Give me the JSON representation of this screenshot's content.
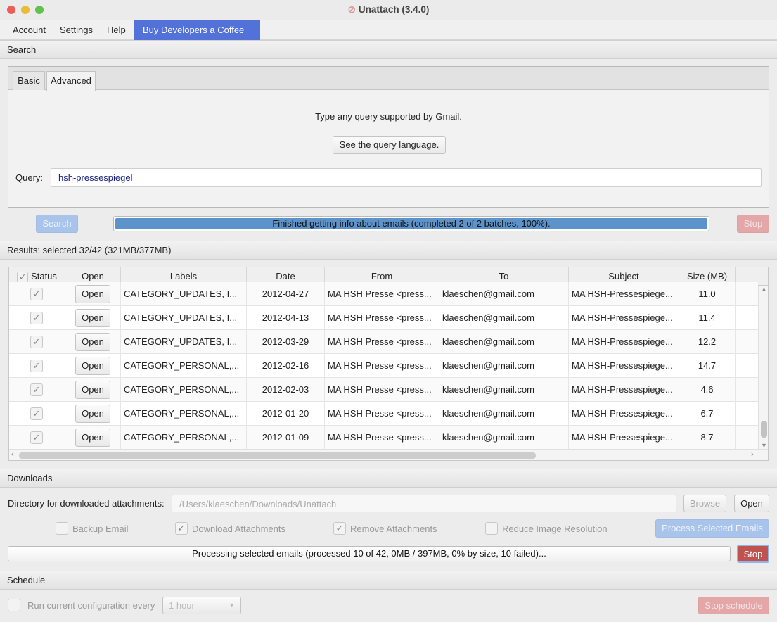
{
  "window": {
    "title": "Unattach (3.4.0)"
  },
  "menu": [
    "Account",
    "Settings",
    "Help",
    "Buy Developers a Coffee ☕"
  ],
  "search": {
    "section": "Search",
    "tabs": [
      "Basic",
      "Advanced"
    ],
    "hint": "Type any query supported by Gmail.",
    "query_lang_button": "See the query language.",
    "query_label": "Query:",
    "query_value": "hsh-pressespiegel",
    "search_button": "Search",
    "progress_text": "Finished getting info about emails (completed 2 of 2 batches, 100%).",
    "progress_percent": 100,
    "stop_button": "Stop"
  },
  "results": {
    "section": "Results: selected 32/42 (321MB/377MB)",
    "columns": [
      "Status",
      "Open",
      "Labels",
      "Date",
      "From",
      "To",
      "Subject",
      "Size (MB)"
    ],
    "rows": [
      {
        "checked": true,
        "open": "Open",
        "labels": "CATEGORY_UPDATES, I...",
        "date": "2012-04-27",
        "from": "MA HSH Presse <press...",
        "to": "klaeschen@gmail.com",
        "subject": "MA HSH-Pressespiege...",
        "size": "11.0"
      },
      {
        "checked": true,
        "open": "Open",
        "labels": "CATEGORY_UPDATES, I...",
        "date": "2012-04-13",
        "from": "MA HSH Presse <press...",
        "to": "klaeschen@gmail.com",
        "subject": "MA HSH-Pressespiege...",
        "size": "11.4"
      },
      {
        "checked": true,
        "open": "Open",
        "labels": "CATEGORY_UPDATES, I...",
        "date": "2012-03-29",
        "from": "MA HSH Presse <press...",
        "to": "klaeschen@gmail.com",
        "subject": "MA HSH-Pressespiege...",
        "size": "12.2"
      },
      {
        "checked": true,
        "open": "Open",
        "labels": "CATEGORY_PERSONAL,...",
        "date": "2012-02-16",
        "from": "MA HSH Presse <press...",
        "to": "klaeschen@gmail.com",
        "subject": "MA HSH-Pressespiege...",
        "size": "14.7"
      },
      {
        "checked": true,
        "open": "Open",
        "labels": "CATEGORY_PERSONAL,...",
        "date": "2012-02-03",
        "from": "MA HSH Presse <press...",
        "to": "klaeschen@gmail.com",
        "subject": "MA HSH-Pressespiege...",
        "size": "4.6"
      },
      {
        "checked": true,
        "open": "Open",
        "labels": "CATEGORY_PERSONAL,...",
        "date": "2012-01-20",
        "from": "MA HSH Presse <press...",
        "to": "klaeschen@gmail.com",
        "subject": "MA HSH-Pressespiege...",
        "size": "6.7"
      },
      {
        "checked": true,
        "open": "Open",
        "labels": "CATEGORY_PERSONAL,...",
        "date": "2012-01-09",
        "from": "MA HSH Presse <press...",
        "to": "klaeschen@gmail.com",
        "subject": "MA HSH-Pressespiege...",
        "size": "8.7"
      }
    ]
  },
  "downloads": {
    "section": "Downloads",
    "dir_label": "Directory for downloaded attachments:",
    "dir_value": "/Users/klaeschen/Downloads/Unattach",
    "browse": "Browse",
    "open": "Open",
    "options": [
      {
        "label": "Backup Email",
        "checked": false
      },
      {
        "label": "Download Attachments",
        "checked": true
      },
      {
        "label": "Remove Attachments",
        "checked": true
      },
      {
        "label": "Reduce Image Resolution",
        "checked": false
      }
    ],
    "process_button": "Process Selected Emails",
    "progress_text": "Processing selected emails (processed 10 of 42, 0MB / 397MB, 0% by size, 10 failed)...",
    "progress_percent": 0,
    "stop": "Stop"
  },
  "schedule": {
    "section": "Schedule",
    "run_label": "Run current configuration every",
    "interval": "1 hour",
    "stop_schedule": "Stop schedule"
  },
  "colors": {
    "accent": "#5272d9",
    "stop_red": "#c0524f",
    "progress_blue": "#5d93cb"
  }
}
